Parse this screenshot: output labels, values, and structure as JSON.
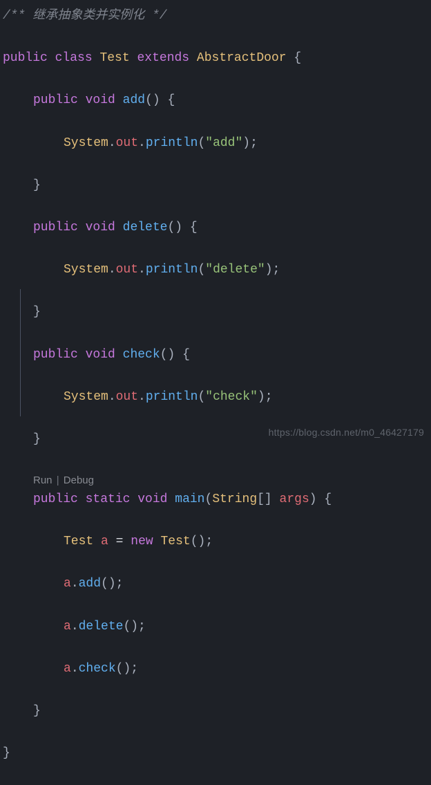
{
  "code": {
    "l1_comment": "/** 继承抽象类并实例化 */",
    "l2_public": "public",
    "l2_class": "class",
    "l2_name": "Test",
    "l2_extends": "extends",
    "l2_parent": "AbstractDoor",
    "add_public": "public",
    "add_void": "void",
    "add_name": "add",
    "add_sys": "System",
    "add_out": "out",
    "add_println": "println",
    "add_str": "\"add\"",
    "del_public": "public",
    "del_void": "void",
    "del_name": "delete",
    "del_sys": "System",
    "del_out": "out",
    "del_println": "println",
    "del_str": "\"delete\"",
    "chk_public": "public",
    "chk_void": "void",
    "chk_name": "check",
    "chk_sys": "System",
    "chk_out": "out",
    "chk_println": "println",
    "chk_str": "\"check\"",
    "main_public": "public",
    "main_static": "static",
    "main_void": "void",
    "main_name": "main",
    "main_ptype": "String",
    "main_brackets": "[]",
    "main_arg": "args",
    "main_type": "Test",
    "main_var": "a",
    "main_eq": "=",
    "main_new": "new",
    "main_ctor": "Test",
    "call1_obj": "a",
    "call1_m": "add",
    "call2_obj": "a",
    "call2_m": "delete",
    "call3_obj": "a",
    "call3_m": "check",
    "brace_open": "{",
    "brace_close": "}",
    "paren_empty": "()",
    "paren_open": "(",
    "paren_close": ")",
    "semi": ";",
    "dot": "."
  },
  "codelens": {
    "run": "Run",
    "debug": "Debug",
    "sep": "|"
  },
  "watermark": "https://blog.csdn.net/m0_46427179"
}
